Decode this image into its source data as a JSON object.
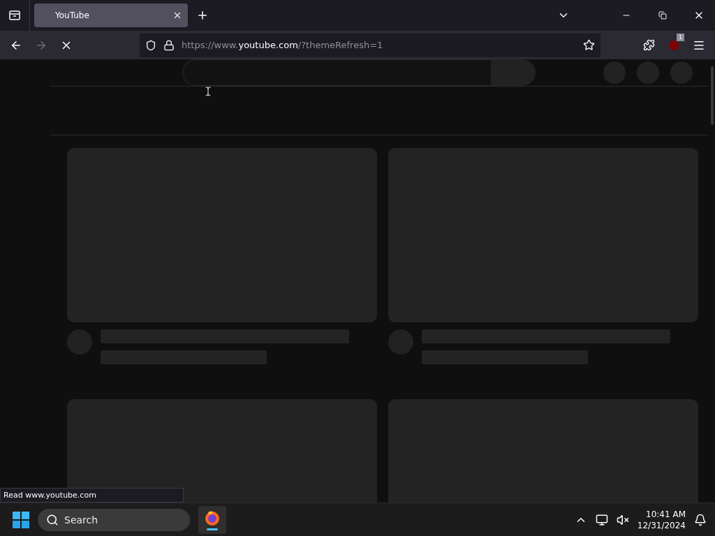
{
  "tabs": [
    {
      "title": "YouTube",
      "selected": true
    }
  ],
  "nav_buttons": [
    {
      "kind": "back",
      "disabled": false
    },
    {
      "kind": "forward",
      "disabled": true
    },
    {
      "kind": "stop",
      "disabled": false
    }
  ],
  "url": {
    "scheme": "https://www.",
    "host": "youtube.com",
    "path": "/?themeRefresh=1"
  },
  "extension_badge": "1",
  "feed": {
    "cards": [
      {
        "kind": "loading"
      },
      {
        "kind": "loading"
      },
      {
        "kind": "loading_cut"
      },
      {
        "kind": "loading_cut"
      }
    ]
  },
  "status_text": "Read www.youtube.com",
  "taskbar": {
    "search": {
      "placeholder": "Search"
    },
    "apps": [
      {
        "kind": "firefox",
        "selected": true
      }
    ],
    "time": "10:41 AM",
    "date": "12/31/2024"
  }
}
